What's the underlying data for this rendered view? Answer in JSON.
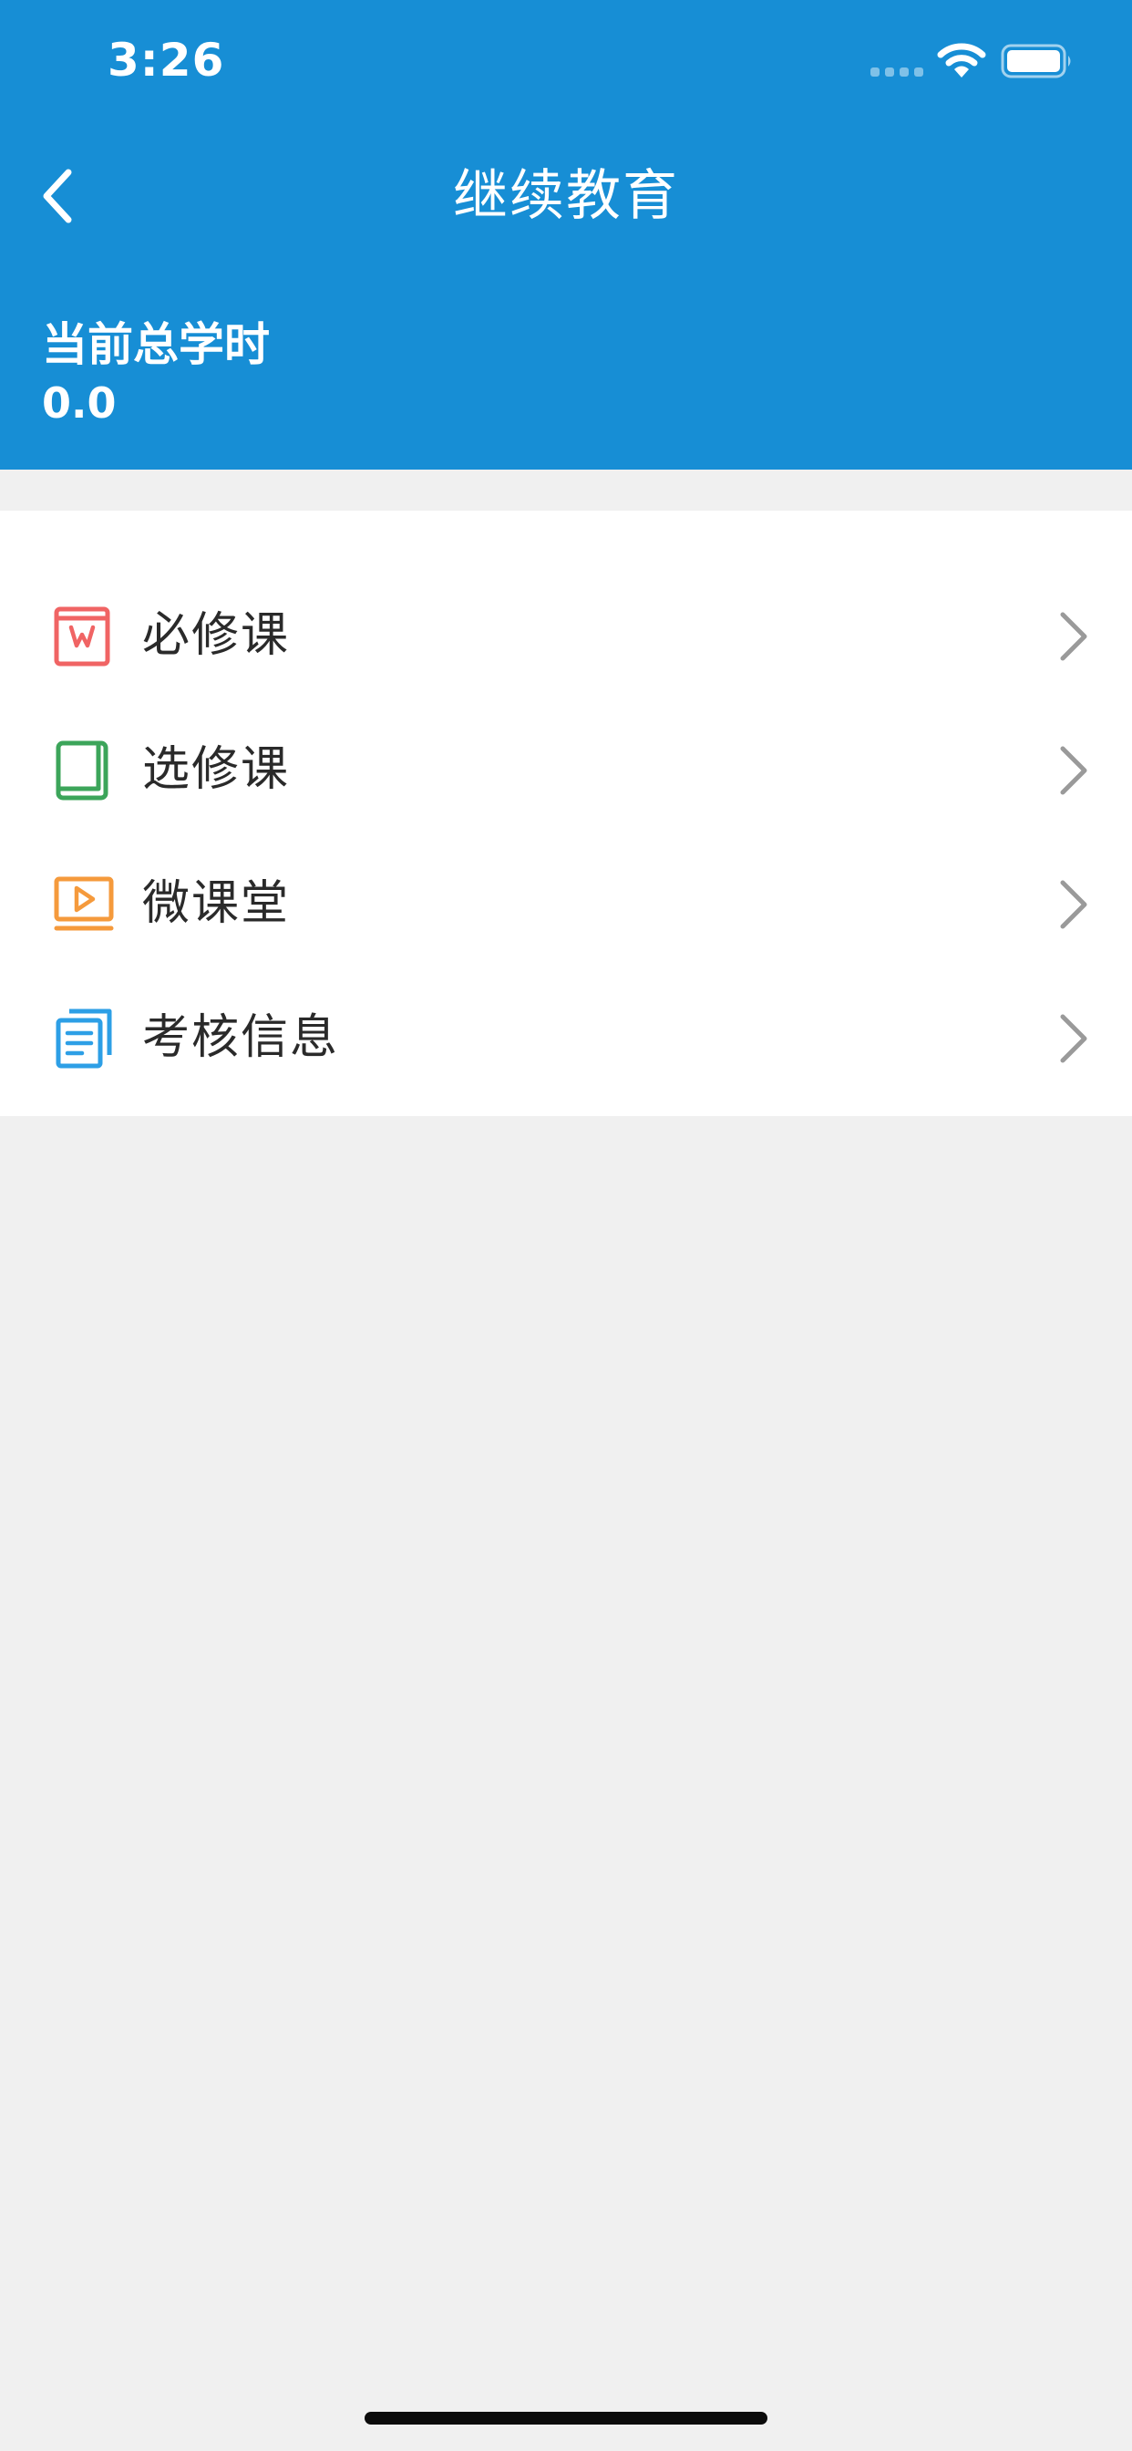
{
  "status_bar": {
    "time": "3:26"
  },
  "nav": {
    "title": "继续教育",
    "back_icon": "chevron-left-icon"
  },
  "summary": {
    "label": "当前总学时",
    "value": "0.0"
  },
  "menu": {
    "items": [
      {
        "label": "必修课",
        "icon": "required-course-icon",
        "color": "#f06464"
      },
      {
        "label": "选修课",
        "icon": "elective-book-icon",
        "color": "#3ca55a"
      },
      {
        "label": "微课堂",
        "icon": "video-play-icon",
        "color": "#f59a3c"
      },
      {
        "label": "考核信息",
        "icon": "documents-icon",
        "color": "#2d9fe6"
      }
    ]
  },
  "colors": {
    "primary": "#178ed5",
    "background": "#f0f0f0",
    "chevron": "#9a9a9a"
  }
}
